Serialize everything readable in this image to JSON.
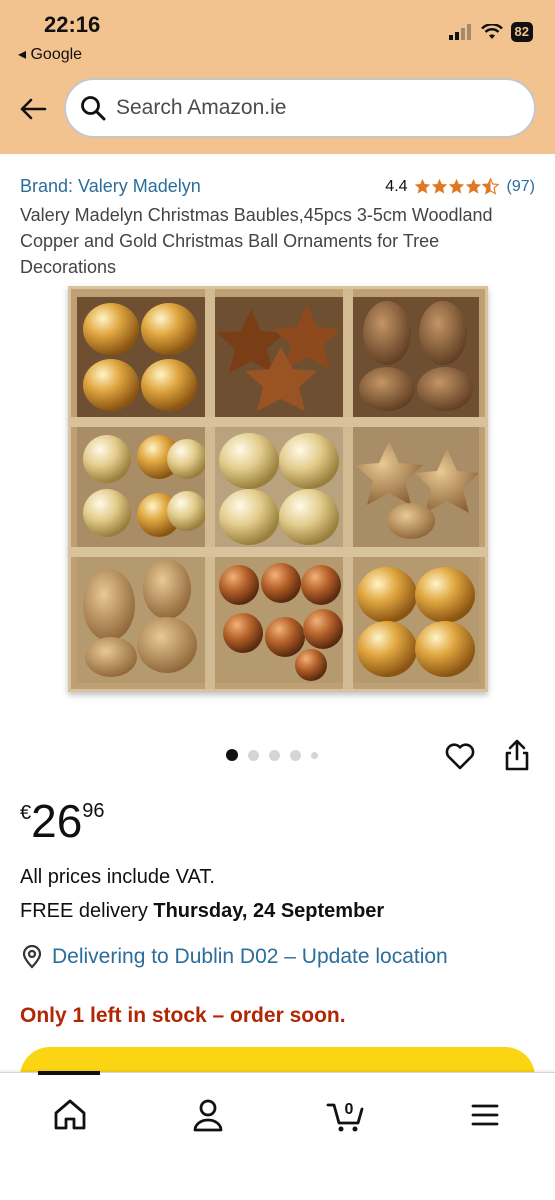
{
  "status": {
    "time": "22:16",
    "back_app": "◂ Google",
    "battery": "82"
  },
  "search": {
    "placeholder": "Search Amazon.ie"
  },
  "product": {
    "brand": "Brand: Valery Madelyn",
    "rating": "4.4",
    "rating_count": "(97)",
    "title": "Valery Madelyn Christmas Baubles,45pcs 3-5cm Woodland Copper and Gold Christmas Ball Ornaments for Tree Decorations",
    "image_count": 5,
    "active_image": 1
  },
  "price": {
    "currency": "€",
    "whole": "26",
    "fraction": "96"
  },
  "info": {
    "vat": "All prices include VAT.",
    "delivery_prefix": "FREE delivery ",
    "delivery_date": "Thursday, 24 September",
    "location": "Delivering to Dublin D02 – Update location",
    "stock": "Only 1 left in stock – order soon."
  },
  "bottom_nav": {
    "cart_count": "0",
    "items": [
      "home-icon",
      "account-icon",
      "cart-icon",
      "menu-icon"
    ]
  },
  "colors": {
    "header": "#f3c38f",
    "link": "#2b6d9c",
    "star": "#de7921",
    "stock": "#b12704",
    "button": "#fbd514"
  }
}
